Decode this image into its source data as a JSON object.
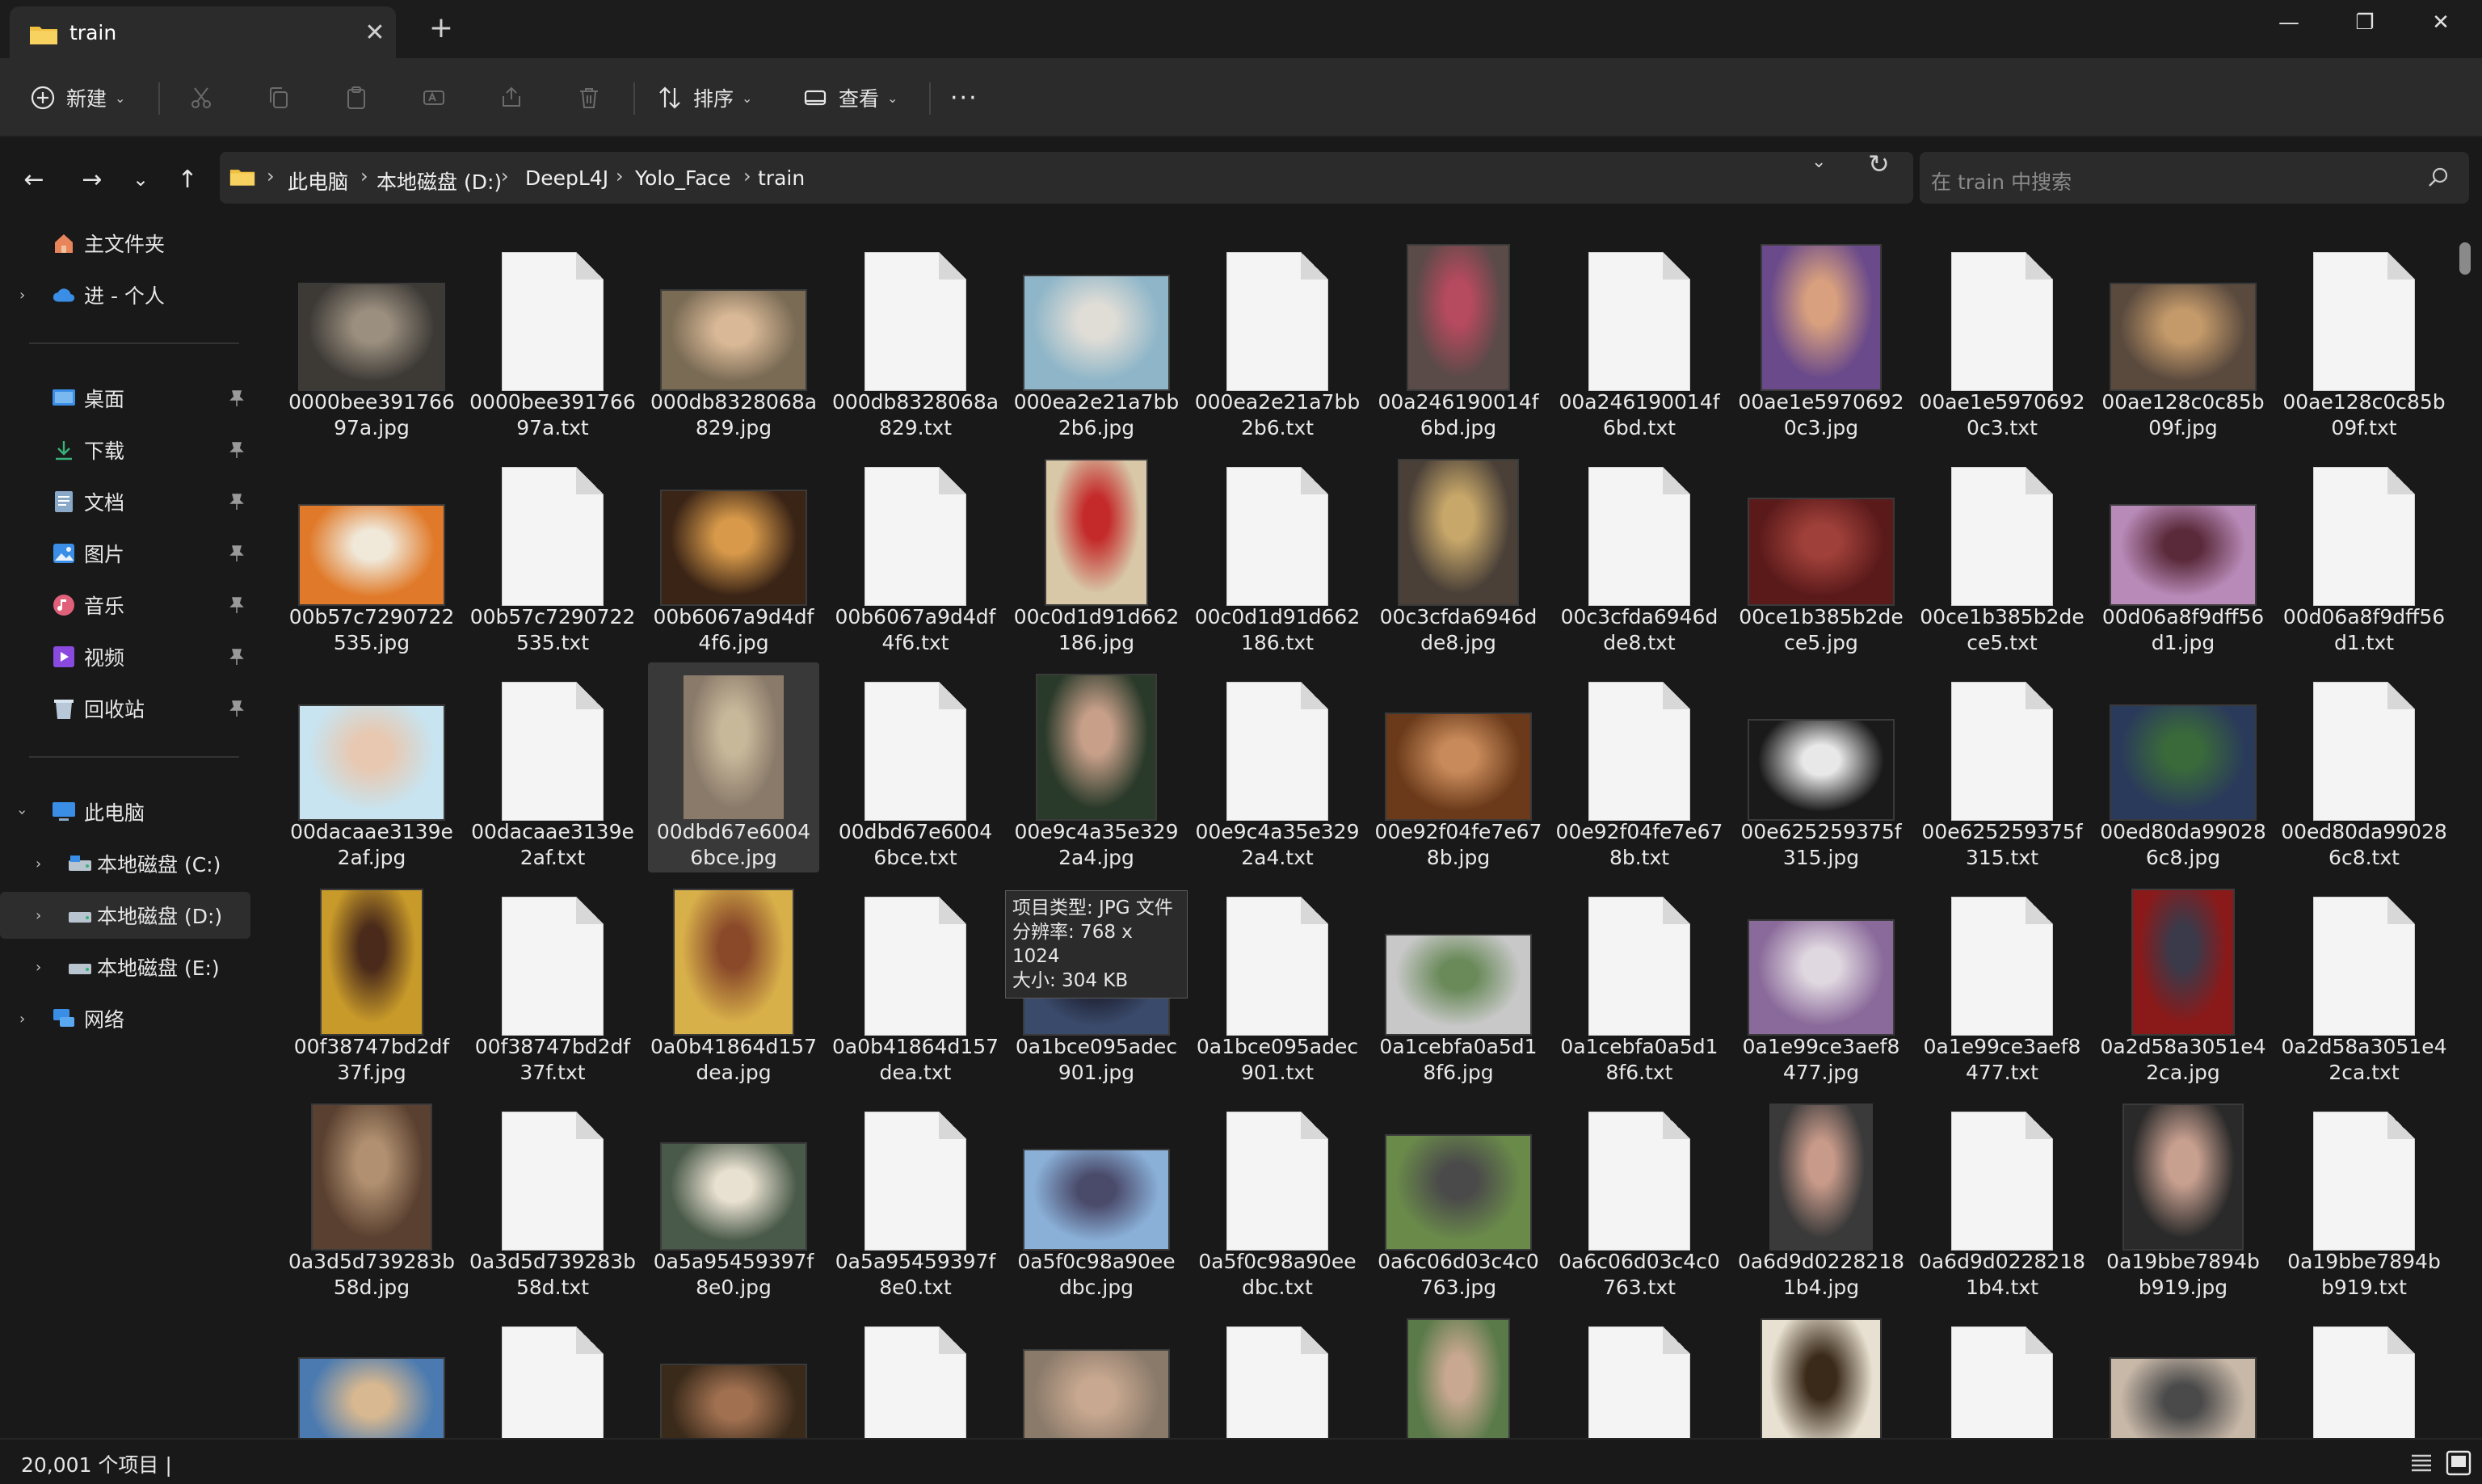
{
  "window": {
    "tab_title": "train",
    "new_tab": "+",
    "minimize": "—",
    "maximize": "❐",
    "close": "✕"
  },
  "commandbar": {
    "new_label": "新建",
    "sort_label": "排序",
    "view_label": "查看",
    "more_label": "···"
  },
  "address": {
    "crumbs": [
      "此电脑",
      "本地磁盘 (D:)",
      "DeepL4J",
      "Yolo_Face",
      "train"
    ],
    "separator": "›",
    "search_placeholder": "在 train 中搜索"
  },
  "sidebar": {
    "home": "主文件夹",
    "cloud": "进 - 个人",
    "quick": [
      "桌面",
      "下载",
      "文档",
      "图片",
      "音乐",
      "视频",
      "回收站"
    ],
    "this_pc": "此电脑",
    "drives": [
      "本地磁盘 (C:)",
      "本地磁盘 (D:)",
      "本地磁盘 (E:)"
    ],
    "network": "网络"
  },
  "files": [
    {
      "name": "0000bee391766 97a.jpg",
      "type": "jpg",
      "colors": [
        "#3d3a36",
        "#9b8f7f"
      ]
    },
    {
      "name": "0000bee391766 97a.txt",
      "type": "txt"
    },
    {
      "name": "000db8328068a 829.jpg",
      "type": "jpg",
      "colors": [
        "#7a6b55",
        "#d8b896"
      ]
    },
    {
      "name": "000db8328068a 829.txt",
      "type": "txt"
    },
    {
      "name": "000ea2e21a7bb 2b6.jpg",
      "type": "jpg",
      "colors": [
        "#8fb6c8",
        "#e0ddd6"
      ]
    },
    {
      "name": "000ea2e21a7bb 2b6.txt",
      "type": "txt"
    },
    {
      "name": "00a246190014f 6bd.jpg",
      "type": "jpg",
      "colors": [
        "#5a4a48",
        "#b64a5e"
      ]
    },
    {
      "name": "00a246190014f 6bd.txt",
      "type": "txt"
    },
    {
      "name": "00ae1e5970692 0c3.jpg",
      "type": "jpg",
      "colors": [
        "#6a4a8a",
        "#d8a07e"
      ]
    },
    {
      "name": "00ae1e5970692 0c3.txt",
      "type": "txt"
    },
    {
      "name": "00ae128c0c85b 09f.jpg",
      "type": "jpg",
      "colors": [
        "#5a4a3e",
        "#c49a6a"
      ]
    },
    {
      "name": "00ae128c0c85b 09f.txt",
      "type": "txt"
    },
    {
      "name": "00b57c7290722 535.jpg",
      "type": "jpg",
      "colors": [
        "#e07a2a",
        "#f0e8d8"
      ]
    },
    {
      "name": "00b57c7290722 535.txt",
      "type": "txt"
    },
    {
      "name": "00b6067a9d4df 4f6.jpg",
      "type": "jpg",
      "colors": [
        "#3a2416",
        "#d89a4a"
      ]
    },
    {
      "name": "00b6067a9d4df 4f6.txt",
      "type": "txt"
    },
    {
      "name": "00c0d1d91d662 186.jpg",
      "type": "jpg",
      "colors": [
        "#d8c8a8",
        "#c42a2a"
      ]
    },
    {
      "name": "00c0d1d91d662 186.txt",
      "type": "txt"
    },
    {
      "name": "00c3cfda6946d de8.jpg",
      "type": "jpg",
      "colors": [
        "#4a4038",
        "#c8a86a"
      ]
    },
    {
      "name": "00c3cfda6946d de8.txt",
      "type": "txt"
    },
    {
      "name": "00ce1b385b2de ce5.jpg",
      "type": "jpg",
      "colors": [
        "#5a1a1a",
        "#a0403a"
      ]
    },
    {
      "name": "00ce1b385b2de ce5.txt",
      "type": "txt"
    },
    {
      "name": "00d06a8f9dff56 d1.jpg",
      "type": "jpg",
      "colors": [
        "#b88ab8",
        "#5a2a3a"
      ]
    },
    {
      "name": "00d06a8f9dff56 d1.txt",
      "type": "txt"
    },
    {
      "name": "00dacaae3139e 2af.jpg",
      "type": "jpg",
      "colors": [
        "#c8e4f0",
        "#e8c8b0"
      ]
    },
    {
      "name": "00dacaae3139e 2af.txt",
      "type": "txt"
    },
    {
      "name": "00dbd67e6004 6bce.jpg",
      "type": "jpg",
      "colors": [
        "#8a7a6a",
        "#c8b89a"
      ],
      "selected": true
    },
    {
      "name": "00dbd67e6004 6bce.txt",
      "type": "txt"
    },
    {
      "name": "00e9c4a35e329 2a4.jpg",
      "type": "jpg",
      "colors": [
        "#2a3a2a",
        "#c8a08a"
      ]
    },
    {
      "name": "00e9c4a35e329 2a4.txt",
      "type": "txt"
    },
    {
      "name": "00e92f04fe7e67 8b.jpg",
      "type": "jpg",
      "colors": [
        "#6a3a1a",
        "#c88a5a"
      ]
    },
    {
      "name": "00e92f04fe7e67 8b.txt",
      "type": "txt"
    },
    {
      "name": "00e625259375f 315.jpg",
      "type": "jpg",
      "colors": [
        "#1a1a1a",
        "#e8e8e8"
      ]
    },
    {
      "name": "00e625259375f 315.txt",
      "type": "txt"
    },
    {
      "name": "00ed80da99028 6c8.jpg",
      "type": "jpg",
      "colors": [
        "#2a3a5a",
        "#3a6a3a"
      ]
    },
    {
      "name": "00ed80da99028 6c8.txt",
      "type": "txt"
    },
    {
      "name": "00f38747bd2df 37f.jpg",
      "type": "jpg",
      "colors": [
        "#c89a2a",
        "#4a2a1a"
      ]
    },
    {
      "name": "00f38747bd2df 37f.txt",
      "type": "txt"
    },
    {
      "name": "0a0b41864d157 dea.jpg",
      "type": "jpg",
      "colors": [
        "#d8b04a",
        "#8a4a2a"
      ]
    },
    {
      "name": "0a0b41864d157 dea.txt",
      "type": "txt"
    },
    {
      "name": "0a1bce095adec 901.jpg",
      "type": "jpg",
      "colors": [
        "#3a4a6a",
        "#1a1a2a"
      ]
    },
    {
      "name": "0a1bce095adec 901.txt",
      "type": "txt"
    },
    {
      "name": "0a1cebfa0a5d1 8f6.jpg",
      "type": "jpg",
      "colors": [
        "#c8c8c8",
        "#6a8a5a"
      ]
    },
    {
      "name": "0a1cebfa0a5d1 8f6.txt",
      "type": "txt"
    },
    {
      "name": "0a1e99ce3aef8 477.jpg",
      "type": "jpg",
      "colors": [
        "#8a6a9a",
        "#e0d8e0"
      ]
    },
    {
      "name": "0a1e99ce3aef8 477.txt",
      "type": "txt"
    },
    {
      "name": "0a2d58a3051e4 2ca.jpg",
      "type": "jpg",
      "colors": [
        "#8a1a1a",
        "#3a3a4a"
      ]
    },
    {
      "name": "0a2d58a3051e4 2ca.txt",
      "type": "txt"
    },
    {
      "name": "0a3d5d739283b 58d.jpg",
      "type": "jpg",
      "colors": [
        "#5a4030",
        "#b09070"
      ]
    },
    {
      "name": "0a3d5d739283b 58d.txt",
      "type": "txt"
    },
    {
      "name": "0a5a95459397f 8e0.jpg",
      "type": "jpg",
      "colors": [
        "#4a5a4a",
        "#e8e0d0"
      ]
    },
    {
      "name": "0a5a95459397f 8e0.txt",
      "type": "txt"
    },
    {
      "name": "0a5f0c98a90ee dbc.jpg",
      "type": "jpg",
      "colors": [
        "#8ab0d8",
        "#4a4a6a"
      ]
    },
    {
      "name": "0a5f0c98a90ee dbc.txt",
      "type": "txt"
    },
    {
      "name": "0a6c06d03c4c0 763.jpg",
      "type": "jpg",
      "colors": [
        "#6a8a4a",
        "#4a4a4a"
      ]
    },
    {
      "name": "0a6c06d03c4c0 763.txt",
      "type": "txt"
    },
    {
      "name": "0a6d9d0228218 1b4.jpg",
      "type": "jpg",
      "colors": [
        "#3a3a3a",
        "#c89a8a"
      ]
    },
    {
      "name": "0a6d9d0228218 1b4.txt",
      "type": "txt"
    },
    {
      "name": "0a19bbe7894b b919.jpg",
      "type": "jpg",
      "colors": [
        "#2a2a2a",
        "#c8a090"
      ]
    },
    {
      "name": "0a19bbe7894b b919.txt",
      "type": "txt"
    },
    {
      "name": "",
      "type": "jpg",
      "colors": [
        "#4a7ab0",
        "#d8b890"
      ]
    },
    {
      "name": "",
      "type": "txt"
    },
    {
      "name": "",
      "type": "jpg",
      "colors": [
        "#3a2a1a",
        "#a07050"
      ]
    },
    {
      "name": "",
      "type": "txt"
    },
    {
      "name": "",
      "type": "jpg",
      "colors": [
        "#8a7a6a",
        "#c8a890"
      ]
    },
    {
      "name": "",
      "type": "txt"
    },
    {
      "name": "",
      "type": "jpg",
      "colors": [
        "#5a7a4a",
        "#c8a890"
      ]
    },
    {
      "name": "",
      "type": "txt"
    },
    {
      "name": "",
      "type": "jpg",
      "colors": [
        "#e8e0d0",
        "#3a2a1a"
      ]
    },
    {
      "name": "",
      "type": "txt"
    },
    {
      "name": "",
      "type": "jpg",
      "colors": [
        "#c8b8a8",
        "#4a4a4a"
      ]
    },
    {
      "name": "",
      "type": "txt"
    }
  ],
  "tooltip": {
    "line1": "项目类型: JPG 文件",
    "line2": "分辨率: 768 x 1024",
    "line3": "大小: 304 KB"
  },
  "status": {
    "count": "20,001 个项目  |"
  },
  "colors": {
    "accent": "#4cc2ff",
    "folder": "#f0c040",
    "background": "#191919"
  }
}
